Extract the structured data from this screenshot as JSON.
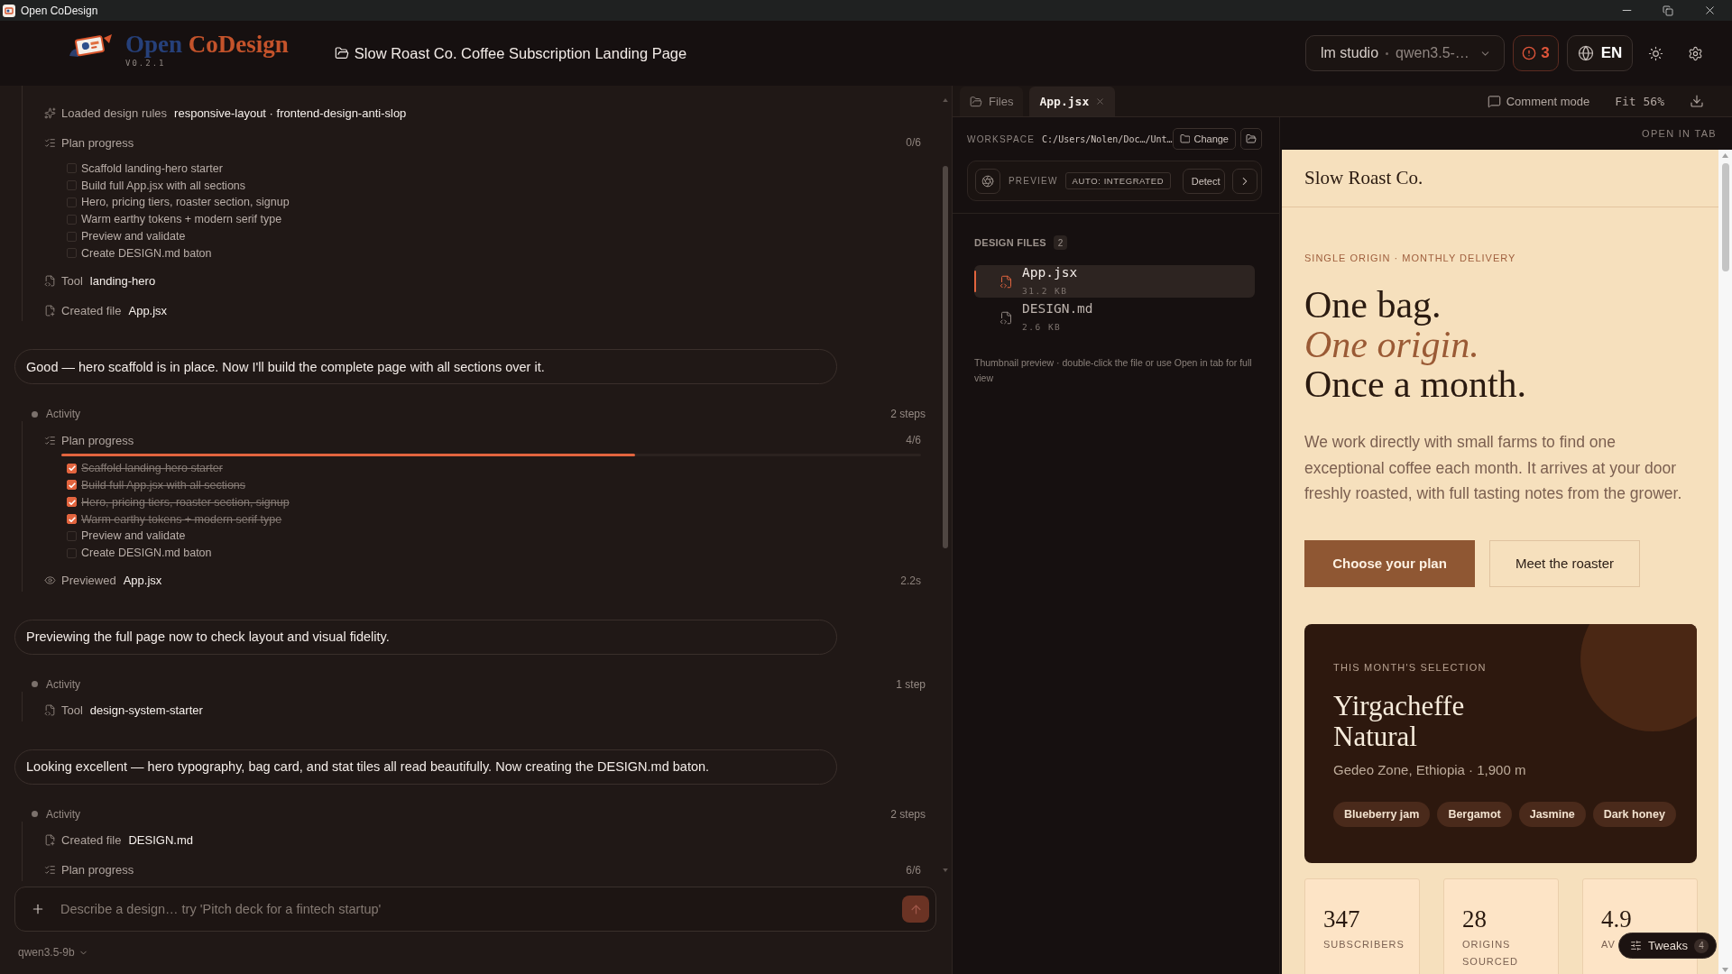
{
  "window": {
    "title": "Open CoDesign"
  },
  "header": {
    "brand": {
      "word_1": "Open",
      "word_2": "CoDesign",
      "version": "V0.2.1"
    },
    "project_title": "Slow Roast Co. Coffee Subscription Landing Page",
    "model_picker": {
      "provider": "lm studio",
      "model": "qwen3.5-…"
    },
    "error_count": "3",
    "language": "EN"
  },
  "chat": {
    "entries": [
      {
        "kind": "activity",
        "items": [
          {
            "kind": "rules",
            "label": "Loaded design rules",
            "value": "responsive-layout · frontend-design-anti-slop"
          },
          {
            "kind": "plan",
            "label": "Plan progress",
            "count": "0/6",
            "tasks": [
              {
                "text": "Scaffold landing-hero starter",
                "checked": false
              },
              {
                "text": "Build full App.jsx with all sections",
                "checked": false
              },
              {
                "text": "Hero, pricing tiers, roaster section, signup",
                "checked": false
              },
              {
                "text": "Warm earthy tokens + modern serif type",
                "checked": false
              },
              {
                "text": "Preview and validate",
                "checked": false
              },
              {
                "text": "Create DESIGN.md baton",
                "checked": false
              }
            ]
          },
          {
            "kind": "tool",
            "label": "Tool",
            "value": "landing-hero"
          },
          {
            "kind": "file",
            "label": "Created file",
            "value": "App.jsx"
          }
        ]
      },
      {
        "kind": "message",
        "text": "Good — hero scaffold is in place. Now I'll build the complete page with all sections over it."
      },
      {
        "kind": "activity",
        "title": "Activity",
        "steps": "2 steps",
        "items": [
          {
            "kind": "plan",
            "label": "Plan progress",
            "count": "4/6",
            "level": 0.667,
            "tasks": [
              {
                "text": "Scaffold landing-hero starter",
                "checked": true
              },
              {
                "text": "Build full App.jsx with all sections",
                "checked": true
              },
              {
                "text": "Hero, pricing tiers, roaster section, signup",
                "checked": true
              },
              {
                "text": "Warm earthy tokens + modern serif type",
                "checked": true
              },
              {
                "text": "Preview and validate",
                "checked": false
              },
              {
                "text": "Create DESIGN.md baton",
                "checked": false
              }
            ]
          },
          {
            "kind": "preview",
            "label": "Previewed",
            "value": "App.jsx",
            "time": "2.2s"
          }
        ]
      },
      {
        "kind": "message",
        "text": "Previewing the full page now to check layout and visual fidelity."
      },
      {
        "kind": "activity",
        "title": "Activity",
        "steps": "1 step",
        "items": [
          {
            "kind": "tool",
            "label": "Tool",
            "value": "design-system-starter"
          }
        ]
      },
      {
        "kind": "message",
        "text": "Looking excellent — hero typography, bag card, and stat tiles all read beautifully. Now creating the DESIGN.md baton."
      },
      {
        "kind": "activity",
        "title": "Activity",
        "steps": "2 steps",
        "items": [
          {
            "kind": "file",
            "label": "Created file",
            "value": "DESIGN.md"
          },
          {
            "kind": "plan",
            "label": "Plan progress",
            "count": "6/6"
          }
        ]
      }
    ]
  },
  "composer": {
    "placeholder": "Describe a design… try 'Pitch deck for a fintech startup'",
    "model": "qwen3.5-9b"
  },
  "workspace": {
    "tabs": [
      {
        "label": "Files",
        "kind": "panel",
        "selected": false,
        "closable": false
      },
      {
        "label": "App.jsx",
        "kind": "file",
        "selected": true,
        "closable": true
      }
    ],
    "comment_mode": "Comment mode",
    "zoom": "Fit 56%",
    "files_panel": {
      "workspace_label": "WORKSPACE",
      "path": "C:/Users/Nolen/Doc…/Unt…",
      "change_button": "Change",
      "preview_label": "PREVIEW",
      "preview_mode": "AUTO: INTEGRATED",
      "detect_button": "Detect",
      "section_title": "DESIGN FILES",
      "file_count": "2",
      "files": [
        {
          "name": "App.jsx",
          "size": "31.2 KB",
          "selected": true
        },
        {
          "name": "DESIGN.md",
          "size": "2.6 KB",
          "selected": false
        }
      ],
      "hint": "Thumbnail preview · double-click the file or use Open in tab for full view"
    },
    "open_in_tab": "OPEN IN TAB"
  },
  "preview": {
    "brand": "Slow Roast Co.",
    "eyebrow": "SINGLE ORIGIN · MONTHLY DELIVERY",
    "headline": [
      {
        "text": "One bag.",
        "italic": false
      },
      {
        "text": "One origin.",
        "italic": true
      },
      {
        "text": "Once a month.",
        "italic": false
      }
    ],
    "lead": "We work directly with small farms to find one exceptional coffee each month. It arrives at your door freshly roasted, with full tasting notes from the grower.",
    "buttons": [
      {
        "label": "Choose your plan",
        "kind": "primary"
      },
      {
        "label": "Meet the roaster",
        "kind": "secondary"
      }
    ],
    "selection": {
      "eyebrow": "THIS MONTH'S SELECTION",
      "name": "Yirgacheffe Natural",
      "origin": "Gedeo Zone, Ethiopia · 1,900 m",
      "notes": [
        "Blueberry jam",
        "Bergamot",
        "Jasmine",
        "Dark honey"
      ]
    },
    "stats": [
      {
        "value": "347",
        "label": "SUBSCRIBERS"
      },
      {
        "value": "28",
        "label": "ORIGINS SOURCED"
      },
      {
        "value": "4.9",
        "label": "AV"
      }
    ],
    "tweaks": {
      "label": "Tweaks",
      "count": "4"
    }
  }
}
